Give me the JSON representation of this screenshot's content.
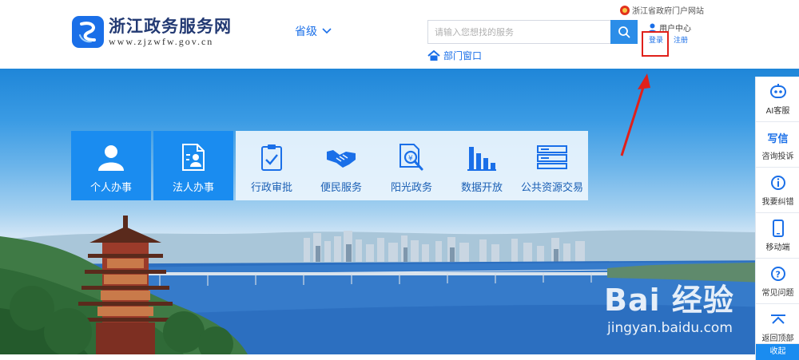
{
  "header": {
    "logo_title": "浙江政务服务网",
    "logo_url": "www.zjzwfw.gov.cn",
    "region_label": "省级",
    "search_placeholder": "请输入您想找的服务",
    "dept_label": "部门窗口",
    "gov_portal_label": "浙江省政府门户网站",
    "user_center_label": "用户中心",
    "login_label": "登录",
    "register_label": "注册"
  },
  "tiles": {
    "personal": "个人办事",
    "legal": "法人办事",
    "approval": "行政审批",
    "public_service": "便民服务",
    "sunshine": "阳光政务",
    "open_data": "数据开放",
    "resource_trade": "公共资源交易"
  },
  "float_bar": {
    "ai_label": "AI客服",
    "complaint_icon_text": "写信",
    "complaint_label": "咨询投诉",
    "correct_label": "我要纠错",
    "mobile_label": "移动端",
    "faq_label": "常见问题",
    "top_label": "返回顶部",
    "collapse_label": "收起"
  },
  "watermark": {
    "main": "Bai 经验",
    "sub": "jingyan.baidu.com"
  },
  "colors": {
    "brand_blue": "#1a8cf0",
    "link_blue": "#1a6fe8",
    "highlight_red": "#e0201a"
  }
}
